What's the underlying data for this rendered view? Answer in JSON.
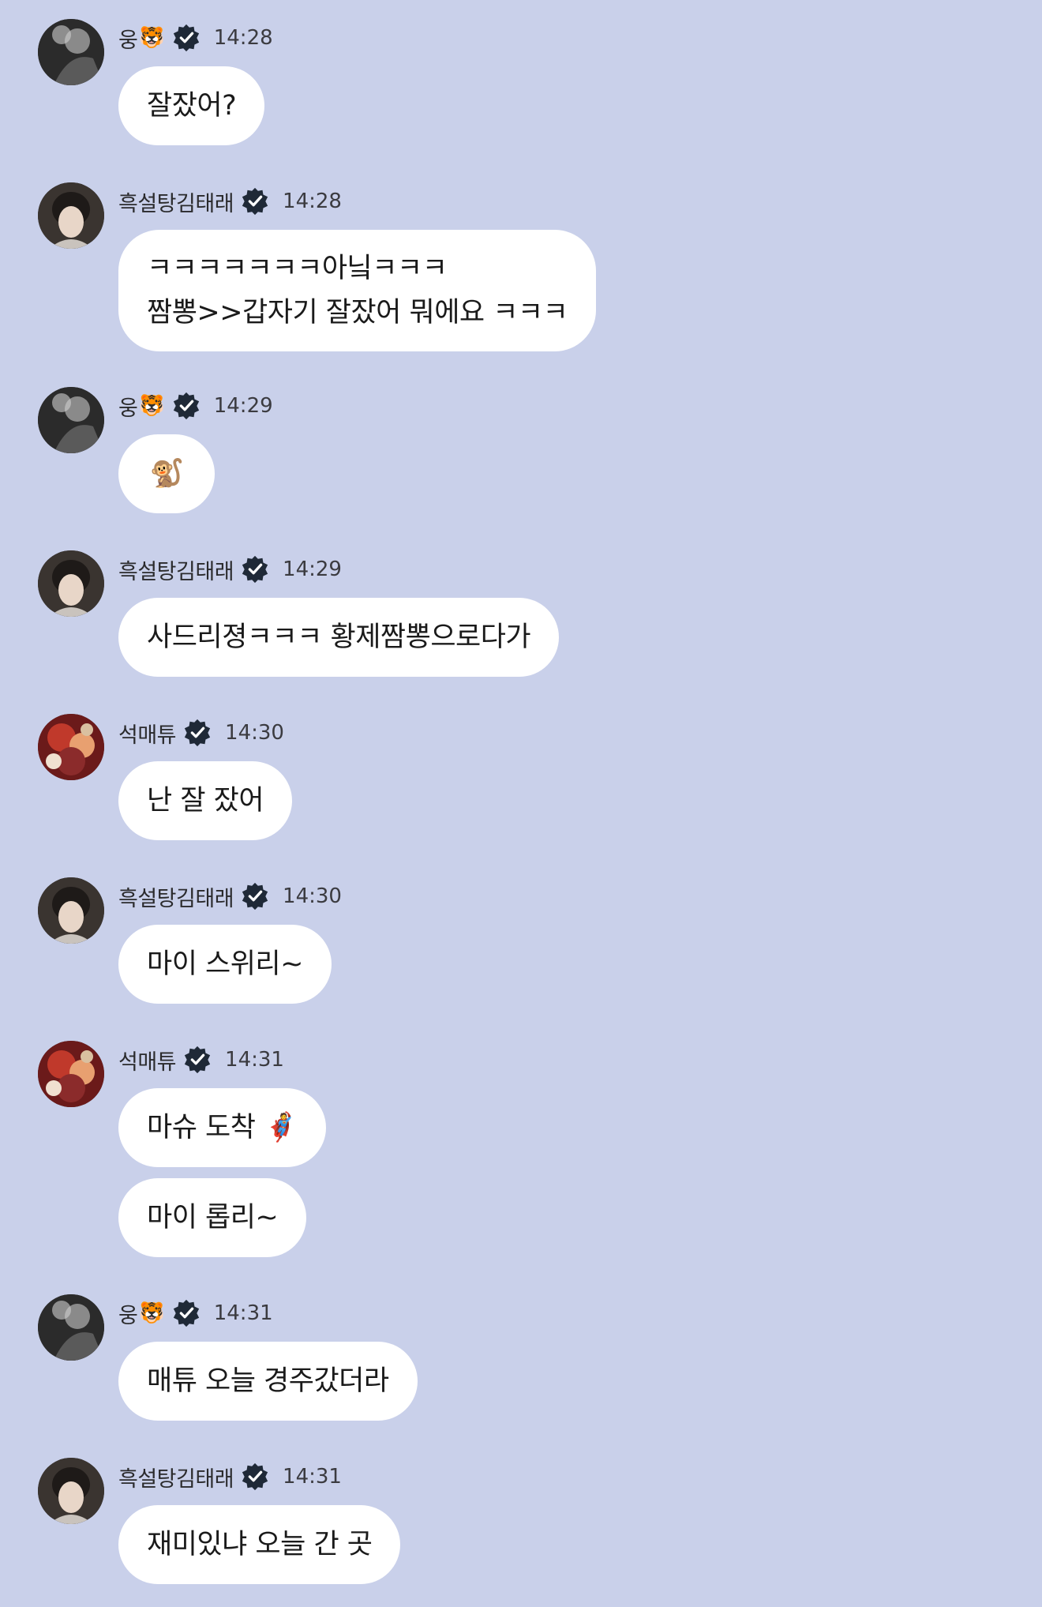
{
  "messages": [
    {
      "sender": "웅",
      "sender_emoji": "🐯",
      "time": "14:28",
      "lines": [
        "잘잤어?"
      ]
    },
    {
      "sender": "흑설탕김태래",
      "sender_emoji": "",
      "time": "14:28",
      "lines": [
        "ㅋㅋㅋㅋㅋㅋㅋ아닠ㅋㅋㅋ",
        "짬뽕>>갑자기 잘잤어 뭐에요 ㅋㅋㅋ"
      ]
    },
    {
      "sender": "웅",
      "sender_emoji": "🐯",
      "time": "14:29",
      "lines": [
        "🐒"
      ]
    },
    {
      "sender": "흑설탕김태래",
      "sender_emoji": "",
      "time": "14:29",
      "lines": [
        "사드리졍ㅋㅋㅋ 황제짬뽕으로다가"
      ]
    },
    {
      "sender": "석매튜",
      "sender_emoji": "",
      "time": "14:30",
      "lines": [
        "난 잘 잤어"
      ]
    },
    {
      "sender": "흑설탕김태래",
      "sender_emoji": "",
      "time": "14:30",
      "lines": [
        "마이 스위리~"
      ]
    },
    {
      "sender": "석매튜",
      "sender_emoji": "",
      "time": "14:31",
      "lines": [
        "마슈 도착 🦸"
      ],
      "second_bubble": "마이 롭리~"
    },
    {
      "sender": "웅",
      "sender_emoji": "🐯",
      "time": "14:31",
      "lines": [
        "매튜 오늘 경주갔더라"
      ]
    },
    {
      "sender": "흑설탕김태래",
      "sender_emoji": "",
      "time": "14:31",
      "lines": [
        "재미있냐 오늘 간 곳"
      ]
    }
  ],
  "colors": {
    "background": "#c9d0ea",
    "bubble": "#ffffff",
    "verified_badge": "#1f2937"
  },
  "icons": {
    "verified": "verified-badge-icon",
    "avatar": "avatar-image"
  }
}
